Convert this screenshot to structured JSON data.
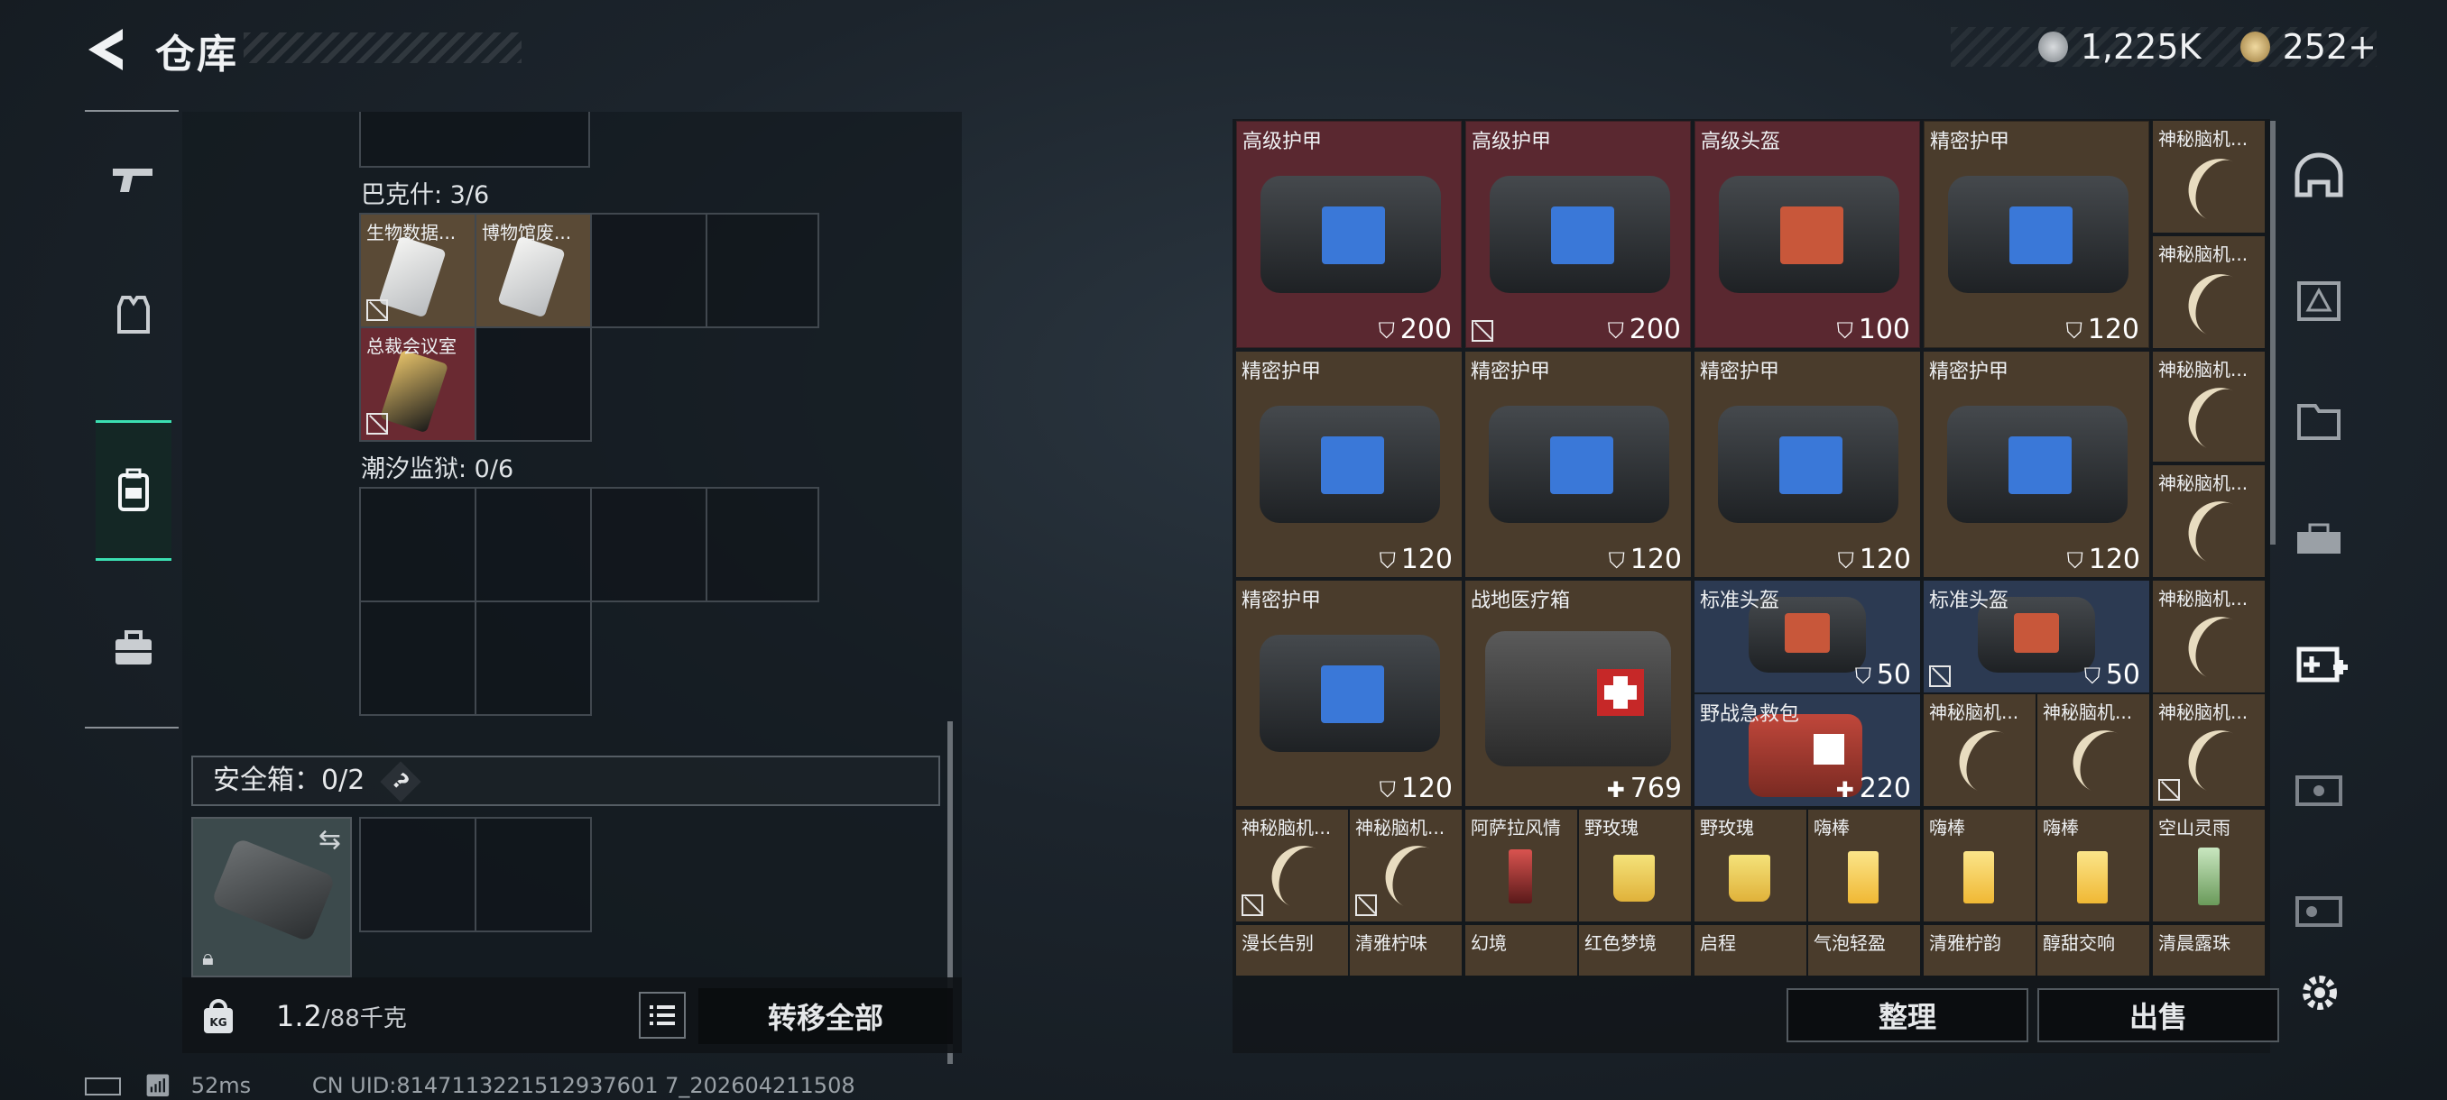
{
  "header": {
    "title": "仓库"
  },
  "currency": {
    "silver": "1,225K",
    "gold": "252+"
  },
  "left": {
    "groups": [
      {
        "label": "巴克什: 3/6"
      },
      {
        "label": "潮汐监狱: 0/6"
      }
    ],
    "items": [
      {
        "name": "生物数据..."
      },
      {
        "name": "博物馆废..."
      },
      {
        "name": "总裁会议室"
      }
    ],
    "safebox": {
      "label": "安全箱：0/2",
      "help": "?"
    },
    "weight": {
      "current": "1.2",
      "max": "/88千克"
    },
    "transfer_all": "转移全部"
  },
  "right": {
    "items": [
      {
        "name": "高级护甲",
        "value": "200"
      },
      {
        "name": "高级护甲",
        "value": "200"
      },
      {
        "name": "高级头盔",
        "value": "100"
      },
      {
        "name": "精密护甲",
        "value": "120"
      },
      {
        "name": "神秘脑机..."
      },
      {
        "name": "神秘脑机..."
      },
      {
        "name": "精密护甲",
        "value": "120"
      },
      {
        "name": "精密护甲",
        "value": "120"
      },
      {
        "name": "精密护甲",
        "value": "120"
      },
      {
        "name": "精密护甲",
        "value": "120"
      },
      {
        "name": "神秘脑机..."
      },
      {
        "name": "神秘脑机..."
      },
      {
        "name": "精密护甲",
        "value": "120"
      },
      {
        "name": "战地医疗箱",
        "value": "769"
      },
      {
        "name": "标准头盔",
        "value": "50"
      },
      {
        "name": "标准头盔",
        "value": "50"
      },
      {
        "name": "神秘脑机..."
      },
      {
        "name": "野战急救包",
        "value": "220"
      },
      {
        "name": "神秘脑机..."
      },
      {
        "name": "神秘脑机..."
      },
      {
        "name": "神秘脑机..."
      },
      {
        "name": "神秘脑机..."
      },
      {
        "name": "神秘脑机..."
      },
      {
        "name": "阿萨拉风情"
      },
      {
        "name": "野玫瑰"
      },
      {
        "name": "野玫瑰"
      },
      {
        "name": "嗨棒"
      },
      {
        "name": "嗨棒"
      },
      {
        "name": "嗨棒"
      },
      {
        "name": "空山灵雨"
      },
      {
        "name": "漫长告别"
      },
      {
        "name": "清雅柠味"
      },
      {
        "name": "幻境"
      },
      {
        "name": "红色梦境"
      },
      {
        "name": "启程"
      },
      {
        "name": "气泡轻盈"
      },
      {
        "name": "清雅柠韵"
      },
      {
        "name": "醇甜交响"
      },
      {
        "name": "清晨露珠"
      }
    ],
    "sort": "整理",
    "sell": "出售"
  },
  "status": {
    "ping": "52ms",
    "uid": "CN UID:8147113221512937601 7_202604211508"
  }
}
